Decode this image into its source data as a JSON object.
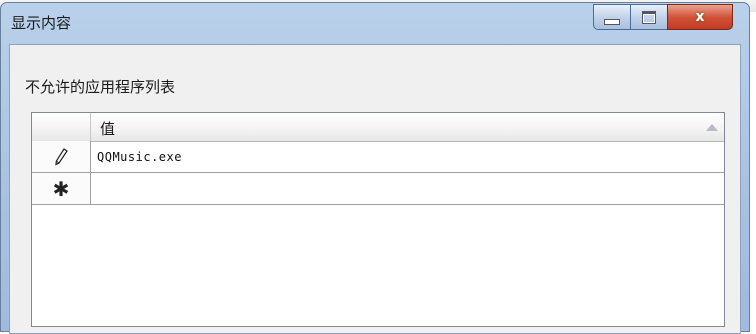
{
  "window": {
    "title": "显示内容",
    "controls": {
      "minimize_icon": "minimize-icon",
      "maximize_icon": "maximize-icon",
      "close_icon": "close-icon",
      "close_glyph": "x"
    },
    "close_color": "#c9452d"
  },
  "content": {
    "label": "不允许的应用程序列表",
    "grid": {
      "column_header": "值",
      "rows": [
        {
          "row_icon": "pencil-icon",
          "value": "QQMusic.exe"
        },
        {
          "row_icon": "new-row-star-icon",
          "glyph": "✱",
          "value": ""
        }
      ]
    }
  }
}
